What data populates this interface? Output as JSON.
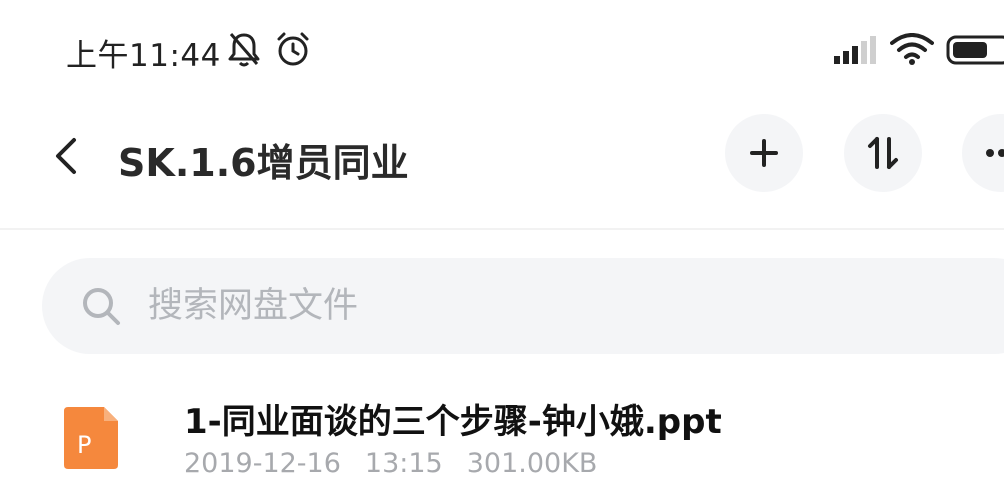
{
  "status_bar": {
    "time": "上午11:44",
    "icons": [
      "bell-muted-icon",
      "alarm-clock-icon",
      "signal-icon",
      "wifi-icon",
      "battery-icon"
    ]
  },
  "header": {
    "title": "SK.1.6增员同业",
    "buttons": [
      "back-icon",
      "plus-icon",
      "sort-icon",
      "more-icon"
    ]
  },
  "search": {
    "placeholder": "搜索网盘文件"
  },
  "files": [
    {
      "name": "1-同业面谈的三个步骤-钟小娥.ppt",
      "type_icon": "ppt-file-icon",
      "type_letter": "P",
      "date": "2019-12-16",
      "time": "13:15",
      "size": "301.00KB"
    }
  ],
  "colors": {
    "ppt_accent": "#f5883d",
    "text_primary": "#111111",
    "text_secondary": "#a7a9ad",
    "placeholder": "#b3b6bb",
    "button_bg": "#f4f5f7"
  }
}
